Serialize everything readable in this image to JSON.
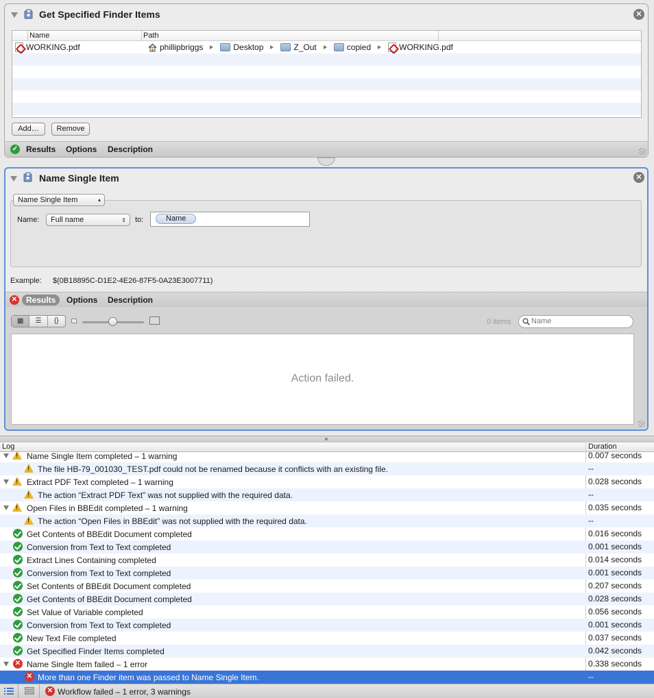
{
  "actions": [
    {
      "title": "Get Specified Finder Items",
      "table": {
        "columns": [
          "Name",
          "Path"
        ],
        "rows": [
          {
            "name": "WORKING.pdf",
            "path": [
              "phillipbriggs",
              "Desktop",
              "Z_Out",
              "copied",
              "WORKING.pdf"
            ]
          }
        ]
      },
      "buttons": {
        "add": "Add…",
        "remove": "Remove"
      },
      "footer_tabs": [
        "Results",
        "Options",
        "Description"
      ],
      "status": "success"
    },
    {
      "title": "Name Single Item",
      "mode_select": "Name Single Item",
      "name_label": "Name:",
      "name_select": "Full name",
      "to_label": "to:",
      "to_token": "Name",
      "example_label": "Example:",
      "example_value": "$(0B18895C-D1E2-4E26-87F5-0A23E3007711)",
      "footer_tabs": [
        "Results",
        "Options",
        "Description"
      ],
      "status": "error",
      "results": {
        "view_buttons": [
          "grid-view",
          "list-view",
          "code-view"
        ],
        "item_count": "0 items",
        "search_placeholder": "Name",
        "message": "Action failed."
      }
    }
  ],
  "log": {
    "columns": {
      "log": "Log",
      "duration": "Duration"
    },
    "rows": [
      {
        "kind": "group",
        "icon": "warning",
        "text": "Name Single Item completed – 1 warning",
        "duration": "0.007 seconds"
      },
      {
        "kind": "child",
        "icon": "warning",
        "text": "The file HB-79_001030_TEST.pdf could not be renamed because it conflicts with an existing file.",
        "duration": "--"
      },
      {
        "kind": "group",
        "icon": "warning",
        "text": "Extract PDF Text completed – 1 warning",
        "duration": "0.028 seconds"
      },
      {
        "kind": "child",
        "icon": "warning",
        "text": "The action “Extract PDF Text” was not supplied with the required data.",
        "duration": "--"
      },
      {
        "kind": "group",
        "icon": "warning",
        "text": "Open Files in BBEdit completed – 1 warning",
        "duration": "0.035 seconds"
      },
      {
        "kind": "child",
        "icon": "warning",
        "text": "The action “Open Files in BBEdit” was not supplied with the required data.",
        "duration": "--"
      },
      {
        "kind": "item",
        "icon": "ok",
        "text": "Get Contents of BBEdit Document completed",
        "duration": "0.016 seconds"
      },
      {
        "kind": "item",
        "icon": "ok",
        "text": "Conversion from Text to Text completed",
        "duration": "0.001 seconds"
      },
      {
        "kind": "item",
        "icon": "ok",
        "text": "Extract Lines Containing completed",
        "duration": "0.014 seconds"
      },
      {
        "kind": "item",
        "icon": "ok",
        "text": "Conversion from Text to Text completed",
        "duration": "0.001 seconds"
      },
      {
        "kind": "item",
        "icon": "ok",
        "text": "Set Contents of BBEdit Document completed",
        "duration": "0.207 seconds"
      },
      {
        "kind": "item",
        "icon": "ok",
        "text": "Get Contents of BBEdit Document completed",
        "duration": "0.028 seconds"
      },
      {
        "kind": "item",
        "icon": "ok",
        "text": "Set Value of Variable completed",
        "duration": "0.056 seconds"
      },
      {
        "kind": "item",
        "icon": "ok",
        "text": "Conversion from Text to Text completed",
        "duration": "0.001 seconds"
      },
      {
        "kind": "item",
        "icon": "ok",
        "text": "New Text File completed",
        "duration": "0.037 seconds"
      },
      {
        "kind": "item",
        "icon": "ok",
        "text": "Get Specified Finder Items completed",
        "duration": "0.042 seconds"
      },
      {
        "kind": "group",
        "icon": "error",
        "text": "Name Single Item failed – 1 error",
        "duration": "0.338 seconds"
      },
      {
        "kind": "child",
        "icon": "error",
        "text": "More than one Finder item was passed to Name Single Item.",
        "duration": "--",
        "selected": true
      }
    ]
  },
  "statusbar": {
    "message": "Workflow failed – 1 error, 3 warnings"
  },
  "colors": {
    "selection": "#3875d7",
    "ok": "#2f9d3a",
    "error": "#d8342b",
    "warning": "#e8b72c",
    "active_border": "#5e8fd6"
  }
}
